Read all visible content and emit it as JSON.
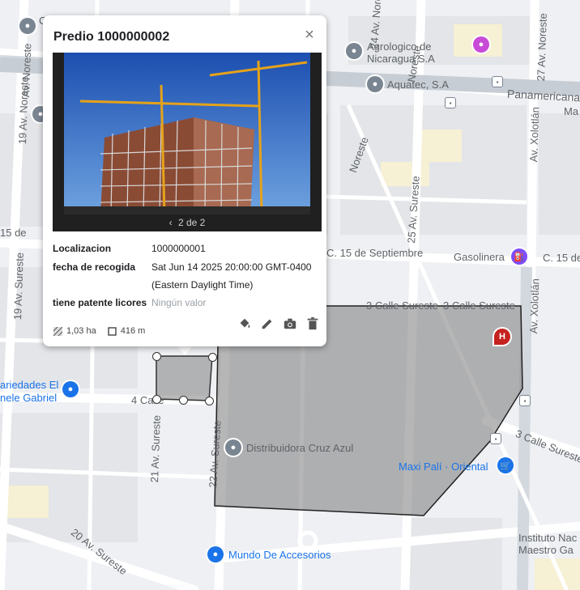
{
  "popup": {
    "title": "Predio 1000000002",
    "close_symbol": "×",
    "carousel": {
      "prev_symbol": "‹",
      "counter": "2 de 2"
    },
    "fields": [
      {
        "key": "Localizacion",
        "value": "1000000001"
      },
      {
        "key": "fecha de recogida",
        "value": "Sat Jun 14 2025 20:00:00 GMT-0400 (Eastern Daylight Time)"
      },
      {
        "key": "tiene patente licores",
        "value": "Ningún valor"
      }
    ],
    "area": "1,03 ha",
    "perimeter": "416 m",
    "actions": [
      "fill-style",
      "edit",
      "camera",
      "delete"
    ]
  },
  "map": {
    "streets": [
      "Av. Noreste",
      "19 Av. Noreste",
      "24 Av. Noreste",
      "27 Av. Noreste",
      "Panamericana",
      "Av. Xolotlán",
      "25 Av. Sureste",
      "C. 15 de Septiembre",
      "C. 15 de",
      "3 Calle Sureste",
      "3 Calle Sureste",
      "19 Av. Sureste",
      "4 Calle",
      "21 Av. Sureste",
      "22 Av. Sureste",
      "20 Av. Sureste",
      "3 Calle Sureste",
      "15 de",
      "Noreste",
      "Noreste",
      "Av. Xolotlán"
    ],
    "pois": [
      {
        "name": "Agrologico de Nicaragua S.A",
        "color": "#5f6368"
      },
      {
        "name": "Aquatec, S.A",
        "color": "#5f6368"
      },
      {
        "name": "Gasolinera",
        "color": "#5f6368"
      },
      {
        "name": "Distribuidora Cruz Azul",
        "color": "#5f6368"
      },
      {
        "name": "Maxi Palí · Oriental",
        "color": "#1a73e8"
      },
      {
        "name": "Mundo De Accesorios",
        "color": "#1a73e8"
      },
      {
        "name": "Instituto Nac Maestro Ga",
        "color": "#5f6368"
      },
      {
        "name": "ariedades El nele Gabriel",
        "color": "#1a73e8"
      },
      {
        "name": "Ma",
        "color": "#5f6368"
      },
      {
        "name": "C",
        "color": "#5f6368"
      }
    ],
    "hospital_symbol": "H",
    "polygon_fill": "#808080"
  }
}
